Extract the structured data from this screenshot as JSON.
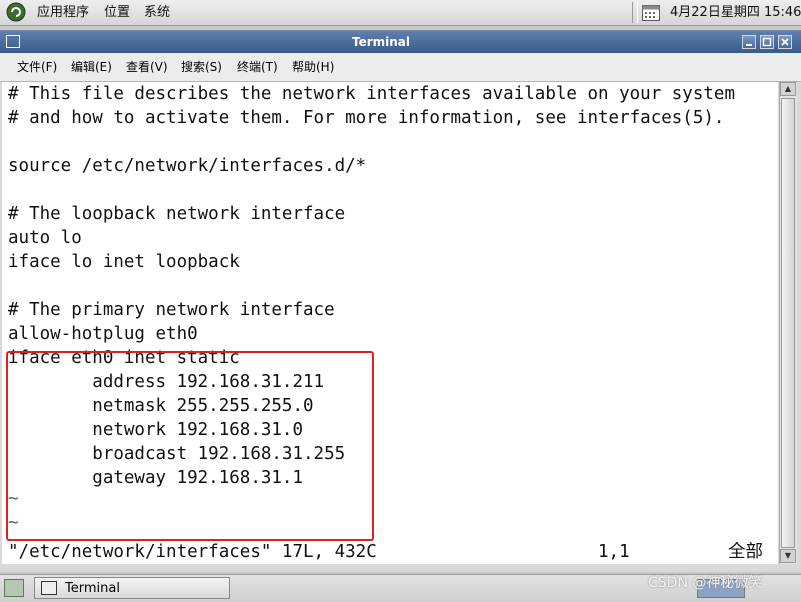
{
  "top_panel": {
    "menus": [
      "应用程序",
      "位置",
      "系统"
    ],
    "clock": "4月22日星期四 15:46"
  },
  "window": {
    "title": "Terminal",
    "menus": [
      "文件(F)",
      "编辑(E)",
      "查看(V)",
      "搜索(S)",
      "终端(T)",
      "帮助(H)"
    ]
  },
  "terminal": {
    "lines": [
      "# This file describes the network interfaces available on your system",
      "# and how to activate them. For more information, see interfaces(5).",
      "",
      "source /etc/network/interfaces.d/*",
      "",
      "# The loopback network interface",
      "auto lo",
      "iface lo inet loopback",
      "",
      "# The primary network interface",
      "allow-hotplug eth0",
      "iface eth0 inet static",
      "        address 192.168.31.211",
      "        netmask 255.255.255.0",
      "        network 192.168.31.0",
      "        broadcast 192.168.31.255",
      "        gateway 192.168.31.1",
      "~",
      "~"
    ],
    "status": {
      "file": "\"/etc/network/interfaces\" 17L, 432C",
      "position": "1,1",
      "percent": "全部"
    }
  },
  "taskbar": {
    "task_label": "Terminal"
  },
  "watermark": "CSDN @神秘微笑",
  "colors": {
    "titlebar": "#4a6a9c",
    "highlight_box": "#dd2222",
    "tilde": "#3b5ba5"
  }
}
